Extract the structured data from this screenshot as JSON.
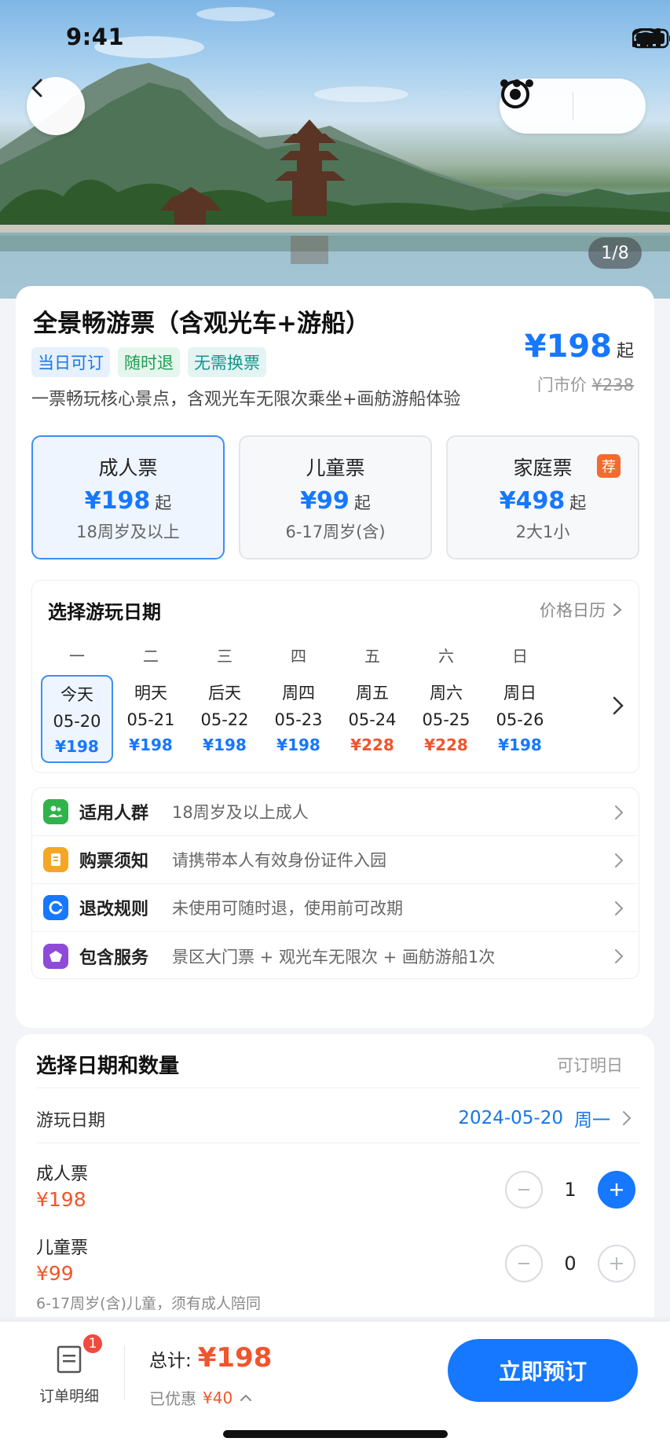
{
  "status_bar": {
    "time": "9:41"
  },
  "hero": {
    "pager": "1/8"
  },
  "product": {
    "title": "全景畅游票（含观光车+游船）",
    "tags": [
      "当日可订",
      "随时退",
      "无需换票"
    ],
    "description": "一票畅玩核心景点，含观光车无限次乘坐+画舫游船体验",
    "price": "¥198",
    "price_suffix": "起",
    "market_label": "门市价",
    "market_price": "¥238"
  },
  "ticket_types": [
    {
      "name": "成人票",
      "price": "¥198",
      "suffix": "起",
      "sub": "18周岁及以上",
      "selected": true
    },
    {
      "name": "儿童票",
      "price": "¥99",
      "suffix": "起",
      "sub": "6-17周岁(含)"
    },
    {
      "name": "家庭票",
      "price": "¥498",
      "suffix": "起",
      "sub": "2大1小",
      "badge": "荐"
    }
  ],
  "date_picker": {
    "title": "选择游玩日期",
    "link": "价格日历",
    "days": [
      {
        "weekday": "一",
        "label": "今天",
        "date": "05-20",
        "price": "¥198",
        "selected": true,
        "color": "#1677ff"
      },
      {
        "weekday": "二",
        "label": "明天",
        "date": "05-21",
        "price": "¥198",
        "color": "#1677ff"
      },
      {
        "weekday": "三",
        "label": "后天",
        "date": "05-22",
        "price": "¥198",
        "color": "#1677ff"
      },
      {
        "weekday": "四",
        "label": "周四",
        "date": "05-23",
        "price": "¥198",
        "color": "#1677ff"
      },
      {
        "weekday": "五",
        "label": "周五",
        "date": "05-24",
        "price": "¥228",
        "color": "#f0552d"
      },
      {
        "weekday": "六",
        "label": "周六",
        "date": "05-25",
        "price": "¥228",
        "color": "#f0552d"
      },
      {
        "weekday": "日",
        "label": "周日",
        "date": "05-26",
        "price": "¥198",
        "color": "#1677ff"
      }
    ]
  },
  "rules": [
    {
      "icon": "people-icon",
      "color": "#2fb34a",
      "label": "适用人群",
      "value": "18周岁及以上成人"
    },
    {
      "icon": "notice-icon",
      "color": "#f5a623",
      "label": "购票须知",
      "value": "请携带本人有效身份证件入园"
    },
    {
      "icon": "refund-icon",
      "color": "#1677ff",
      "label": "退改规则",
      "value": "未使用可随时退，使用前可改期"
    },
    {
      "icon": "service-icon",
      "color": "#8e4bd8",
      "label": "包含服务",
      "value": "景区大门票 + 观光车无限次 + 画舫游船1次"
    }
  ],
  "quantity": {
    "title": "选择日期和数量",
    "note": "可订明日",
    "play_date_label": "游玩日期",
    "play_date_value": "2024-05-20",
    "play_date_weekday": "周一",
    "items": [
      {
        "name": "成人票",
        "price": "¥198",
        "count": "1"
      },
      {
        "name": "儿童票",
        "price": "¥99",
        "count": "0",
        "hint": "6-17周岁(含)儿童，须有成人陪同"
      }
    ]
  },
  "bottom": {
    "detail_label": "订单明细",
    "badge": "1",
    "total_label": "总计:",
    "total_value": "¥198",
    "saved_label": "已优惠",
    "saved_value": "¥40",
    "book_label": "立即预订"
  },
  "colors": {
    "accent": "#1677ff",
    "price_red": "#f0552d"
  }
}
